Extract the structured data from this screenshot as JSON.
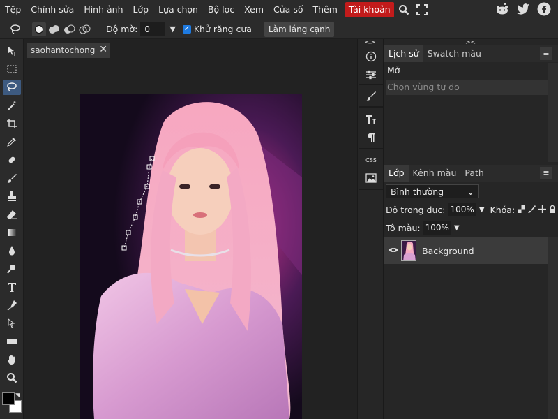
{
  "menu": {
    "items": [
      "Tệp",
      "Chỉnh sửa",
      "Hình ảnh",
      "Lớp",
      "Lựa chọn",
      "Bộ lọc",
      "Xem",
      "Cửa số",
      "Thêm"
    ],
    "account": "Tài khoản"
  },
  "options": {
    "feather_label": "Độ mờ:",
    "feather_value": "0 px",
    "antialias_label": "Khử răng cưa",
    "antialias_checked": true,
    "refine_label": "Làm láng cạnh"
  },
  "document": {
    "tab_name": "saohantochong"
  },
  "history_panel": {
    "tabs": [
      "Lịch sử",
      "Swatch màu"
    ],
    "items": [
      "Mở",
      "Chọn vùng tự do"
    ]
  },
  "layers_panel": {
    "tabs": [
      "Lớp",
      "Kênh màu",
      "Path"
    ],
    "blend_mode": "Bình thường",
    "opacity_label": "Độ trong đục:",
    "opacity_value": "100%",
    "lock_label": "Khóa:",
    "fill_label": "Tô màu:",
    "fill_value": "100%",
    "layers": [
      {
        "name": "Background"
      }
    ]
  },
  "mid_panel": {
    "css_label": "CSS"
  },
  "colors": {
    "account_bg": "#c21b1b",
    "foreground": "#000000",
    "background": "#ffffff",
    "selected_tool": "#3d5a80"
  }
}
